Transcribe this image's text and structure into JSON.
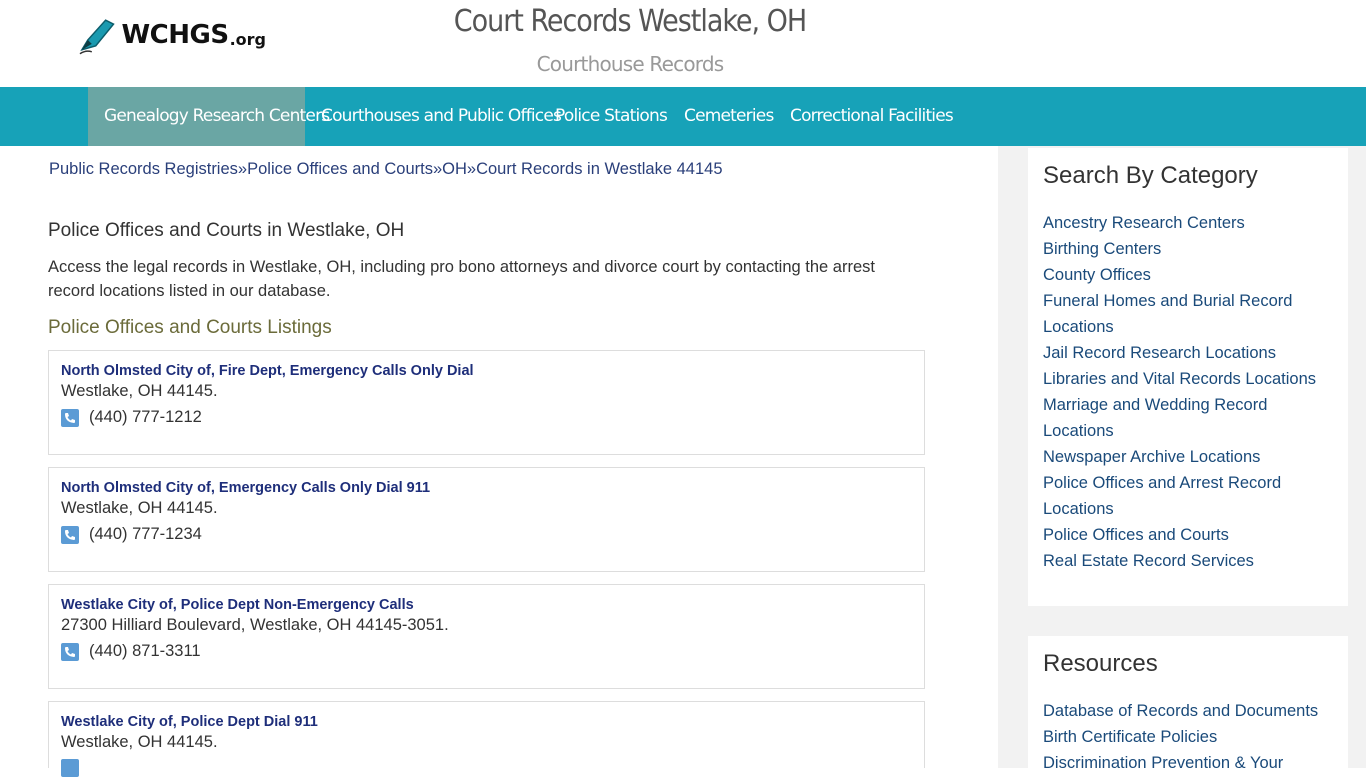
{
  "header": {
    "logo_text": "WCHGS",
    "logo_suffix": ".org",
    "site_title": "Court Records Westlake, OH",
    "site_subtitle": "Courthouse Records"
  },
  "nav": {
    "items": [
      {
        "label": "Genealogy Research Centers"
      },
      {
        "label": "Courthouses and Public Offices"
      },
      {
        "label": "Police Stations"
      },
      {
        "label": "Cemeteries"
      },
      {
        "label": "Correctional Facilities"
      }
    ]
  },
  "breadcrumb": {
    "items": [
      "Public Records Registries",
      "Police Offices and Courts",
      "OH",
      "Court Records in Westlake 44145"
    ],
    "separator": "»"
  },
  "main": {
    "heading": "Police Offices and Courts in Westlake, OH",
    "intro": "Access the legal records in Westlake, OH, including pro bono attorneys and divorce court by contacting the arrest record locations listed in our database.",
    "listings_heading": "Police Offices and Courts Listings",
    "listings": [
      {
        "title": "North Olmsted City of, Fire Dept, Emergency Calls Only Dial",
        "address": "Westlake, OH 44145.",
        "phone": "(440) 777-1212"
      },
      {
        "title": "North Olmsted City of, Emergency Calls Only Dial 911",
        "address": "Westlake, OH 44145.",
        "phone": "(440) 777-1234"
      },
      {
        "title": "Westlake City of, Police Dept Non-Emergency Calls",
        "address": "27300 Hilliard Boulevard, Westlake, OH 44145-3051.",
        "phone": "(440) 871-3311"
      },
      {
        "title": "Westlake City of, Police Dept Dial 911",
        "address": "Westlake, OH 44145.",
        "phone": ""
      }
    ]
  },
  "sidebar": {
    "category_title": "Search By Category",
    "categories": [
      "Ancestry Research Centers",
      "Birthing Centers",
      "County Offices",
      "Funeral Homes and Burial Record Locations",
      "Jail Record Research Locations",
      "Libraries and Vital Records Locations",
      "Marriage and Wedding Record Locations",
      "Newspaper Archive Locations",
      "Police Offices and Arrest Record Locations",
      "Police Offices and Courts",
      "Real Estate Record Services"
    ],
    "resources_title": "Resources",
    "resources": [
      "Database of Records and Documents",
      "Birth Certificate Policies",
      "Discrimination Prevention & Your"
    ]
  },
  "colors": {
    "nav_bg": "#17a2b8",
    "nav_active_bg": "#6aa6a4",
    "link": "#1a4a7a",
    "phone_icon": "#5b9bd5"
  }
}
